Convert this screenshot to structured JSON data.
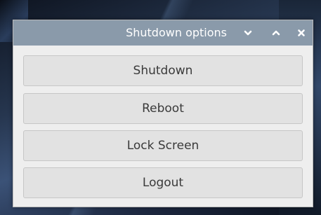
{
  "window": {
    "title": "Shutdown options",
    "titlebar_color": "#8a9aaa",
    "controls": {
      "minimize_icon": "chevron-down-icon",
      "maximize_icon": "chevron-up-icon",
      "close_icon": "close-icon"
    }
  },
  "actions": {
    "shutdown_label": "Shutdown",
    "reboot_label": "Reboot",
    "lock_screen_label": "Lock Screen",
    "logout_label": "Logout"
  }
}
